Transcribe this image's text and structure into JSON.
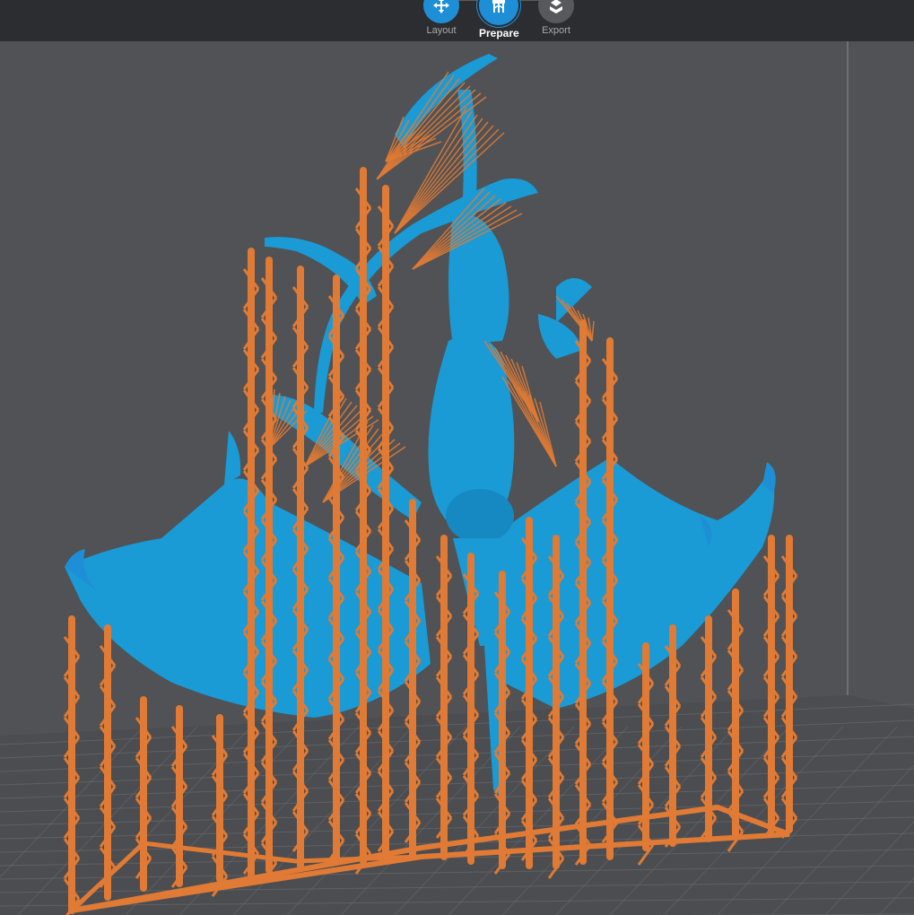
{
  "stages": {
    "layout": {
      "label": "Layout",
      "icon": "move-arrows-icon"
    },
    "prepare": {
      "label": "Prepare",
      "icon": "supports-icon"
    },
    "export": {
      "label": "Export",
      "icon": "export-tray-icon"
    }
  },
  "colors": {
    "topbar": "#2c2d30",
    "viewport_bg": "#505255",
    "accent_blue": "#1e8fd6",
    "model": "#1a9bd6",
    "supports": "#e07a34",
    "grid": "#6b6d70"
  }
}
